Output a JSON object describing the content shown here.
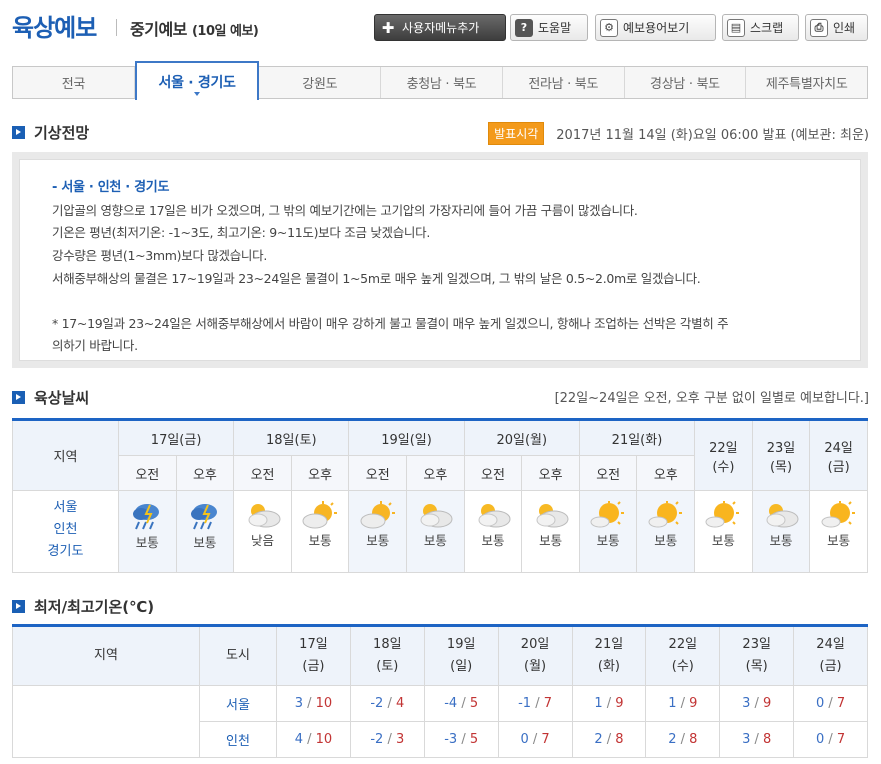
{
  "header": {
    "title": "육상예보",
    "subtitle": "중기예보",
    "subtitle_small": "(10일 예보)",
    "buttons": {
      "add_menu": "사용자메뉴추가",
      "help": "도움말",
      "glossary": "예보용어보기",
      "scrap": "스크랩",
      "print": "인쇄"
    }
  },
  "tabs": [
    "전국",
    "서울 · 경기도",
    "강원도",
    "충청남 · 북도",
    "전라남 · 북도",
    "경상남 · 북도",
    "제주특별자치도"
  ],
  "outlook": {
    "section_title": "기상전망",
    "badge": "발표시각",
    "published": "2017년 11월 14일 (화)요일 06:00 발표 (예보관: 최운)",
    "heading": "- 서울 · 인천 · 경기도",
    "lines": [
      "기압골의 영향으로 17일은 비가 오겠으며, 그 밖의 예보기간에는 고기압의 가장자리에 들어 가끔 구름이 많겠습니다.",
      "기온은 평년(최저기온: -1~3도, 최고기온: 9~11도)보다 조금 낮겠습니다.",
      "강수량은 평년(1~3mm)보다 많겠습니다.",
      "서해중부해상의 물결은 17~19일과 23~24일은 물결이 1~5m로 매우 높게 일겠으며, 그 밖의 날은 0.5~2.0m로 일겠습니다."
    ],
    "note_line1": "* 17~19일과 23~24일은 서해중부해상에서 바람이 매우 강하게 불고 물결이 매우 높게 일겠으니, 항해나 조업하는 선박은 각별히 주",
    "note_line2": "의하기 바랍니다."
  },
  "weather": {
    "section_title": "육상날씨",
    "note": "[22일~24일은 오전, 오후 구분 없이 일별로 예보합니다.]",
    "region_header": "지역",
    "ampm_days": [
      "17일(금)",
      "18일(토)",
      "19일(일)",
      "20일(월)",
      "21일(화)"
    ],
    "am": "오전",
    "pm": "오후",
    "whole_days": [
      {
        "day": "22일",
        "dow": "(수)"
      },
      {
        "day": "23일",
        "dow": "(목)"
      },
      {
        "day": "24일",
        "dow": "(금)"
      }
    ],
    "region": [
      "서울",
      "인천",
      "경기도"
    ],
    "cells": [
      {
        "icon": "rain-icon",
        "label": "보통"
      },
      {
        "icon": "rain-icon",
        "label": "보통"
      },
      {
        "icon": "cloudy-icon",
        "label": "낮음"
      },
      {
        "icon": "partly-cloudy-icon",
        "label": "보통"
      },
      {
        "icon": "partly-cloudy-icon",
        "label": "보통"
      },
      {
        "icon": "cloudy-icon",
        "label": "보통"
      },
      {
        "icon": "cloudy-icon",
        "label": "보통"
      },
      {
        "icon": "cloudy-icon",
        "label": "보통"
      },
      {
        "icon": "sunny-cloud-icon",
        "label": "보통"
      },
      {
        "icon": "sunny-cloud-icon",
        "label": "보통"
      },
      {
        "icon": "sunny-cloud-icon",
        "label": "보통"
      },
      {
        "icon": "cloudy-icon",
        "label": "보통"
      },
      {
        "icon": "sunny-cloud-icon",
        "label": "보통"
      }
    ]
  },
  "temps": {
    "section_title": "최저/최고기온(℃)",
    "region_header": "지역",
    "city_header": "도시",
    "days": [
      {
        "day": "17일",
        "dow": "(금)"
      },
      {
        "day": "18일",
        "dow": "(토)"
      },
      {
        "day": "19일",
        "dow": "(일)"
      },
      {
        "day": "20일",
        "dow": "(월)"
      },
      {
        "day": "21일",
        "dow": "(화)"
      },
      {
        "day": "22일",
        "dow": "(수)"
      },
      {
        "day": "23일",
        "dow": "(목)"
      },
      {
        "day": "24일",
        "dow": "(금)"
      }
    ],
    "rows": [
      {
        "city": "서울",
        "values": [
          [
            "3",
            "10"
          ],
          [
            "-2",
            "4"
          ],
          [
            "-4",
            "5"
          ],
          [
            "-1",
            "7"
          ],
          [
            "1",
            "9"
          ],
          [
            "1",
            "9"
          ],
          [
            "3",
            "9"
          ],
          [
            "0",
            "7"
          ]
        ]
      },
      {
        "city": "인천",
        "values": [
          [
            "4",
            "10"
          ],
          [
            "-2",
            "3"
          ],
          [
            "-3",
            "5"
          ],
          [
            "0",
            "7"
          ],
          [
            "2",
            "8"
          ],
          [
            "2",
            "8"
          ],
          [
            "3",
            "8"
          ],
          [
            "0",
            "7"
          ]
        ]
      }
    ]
  },
  "colors": {
    "accent": "#1d5fb4",
    "badge": "#f39a1b",
    "low": "#3a6fc4",
    "high": "#c23434"
  }
}
